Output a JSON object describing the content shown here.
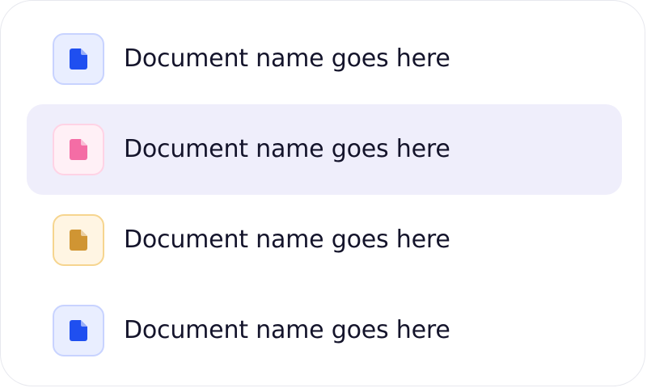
{
  "documents": {
    "items": [
      {
        "name": "Document name goes here",
        "icon": "file-icon",
        "selected": false,
        "colors": {
          "fill": "#1F4FF0",
          "bg": "#E9EEFF",
          "border": "#C8D3FF"
        }
      },
      {
        "name": "Document name goes here",
        "icon": "file-icon",
        "selected": true,
        "colors": {
          "fill": "#F46DA5",
          "bg": "#FFF0F6",
          "border": "#FFD3E5"
        }
      },
      {
        "name": "Document name goes here",
        "icon": "file-icon",
        "selected": false,
        "colors": {
          "fill": "#D09533",
          "bg": "#FFF5E3",
          "border": "#F6D58F"
        }
      },
      {
        "name": "Document name goes here",
        "icon": "file-icon",
        "selected": false,
        "colors": {
          "fill": "#1F4FF0",
          "bg": "#E9EEFF",
          "border": "#C8D3FF"
        }
      }
    ]
  },
  "theme": {
    "selected_row_bg": "#EFEEFB",
    "text_color": "#14142B",
    "card_border": "#E7E8EE"
  }
}
